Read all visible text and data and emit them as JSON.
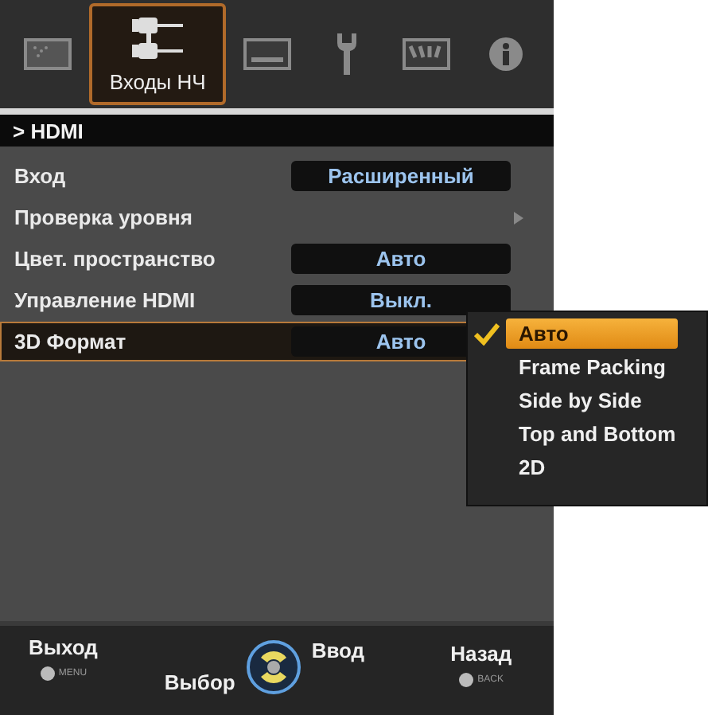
{
  "tabs": [
    {
      "kind": "picture",
      "selected": false
    },
    {
      "kind": "inputs",
      "label": "Входы НЧ",
      "selected": true
    },
    {
      "kind": "screen",
      "selected": false
    },
    {
      "kind": "wrench",
      "selected": false
    },
    {
      "kind": "keypad",
      "selected": false
    },
    {
      "kind": "info",
      "selected": false
    }
  ],
  "breadcrumb": "> HDMI",
  "rows": [
    {
      "kind": "value",
      "label": "Вход",
      "value": "Расширенный",
      "selected": false
    },
    {
      "kind": "submenu",
      "label": "Проверка уровня",
      "selected": false
    },
    {
      "kind": "value",
      "label": "Цвет. пространство",
      "value": "Авто",
      "selected": false
    },
    {
      "kind": "value",
      "label": "Управление HDMI",
      "value": "Выкл.",
      "selected": false
    },
    {
      "kind": "value",
      "label": "3D Формат",
      "value": "Авто",
      "selected": true
    }
  ],
  "popup": [
    {
      "label": "Авто",
      "selected": true,
      "checked": true
    },
    {
      "label": "Frame Packing",
      "selected": false,
      "checked": false
    },
    {
      "label": "Side by Side",
      "selected": false,
      "checked": false
    },
    {
      "label": "Top and Bottom",
      "selected": false,
      "checked": false
    },
    {
      "label": "2D",
      "selected": false,
      "checked": false
    }
  ],
  "footer": {
    "exit": {
      "label": "Выход",
      "key": "MENU"
    },
    "select": "Выбор",
    "enter": "Ввод",
    "back": {
      "label": "Назад",
      "key": "BACK"
    }
  }
}
